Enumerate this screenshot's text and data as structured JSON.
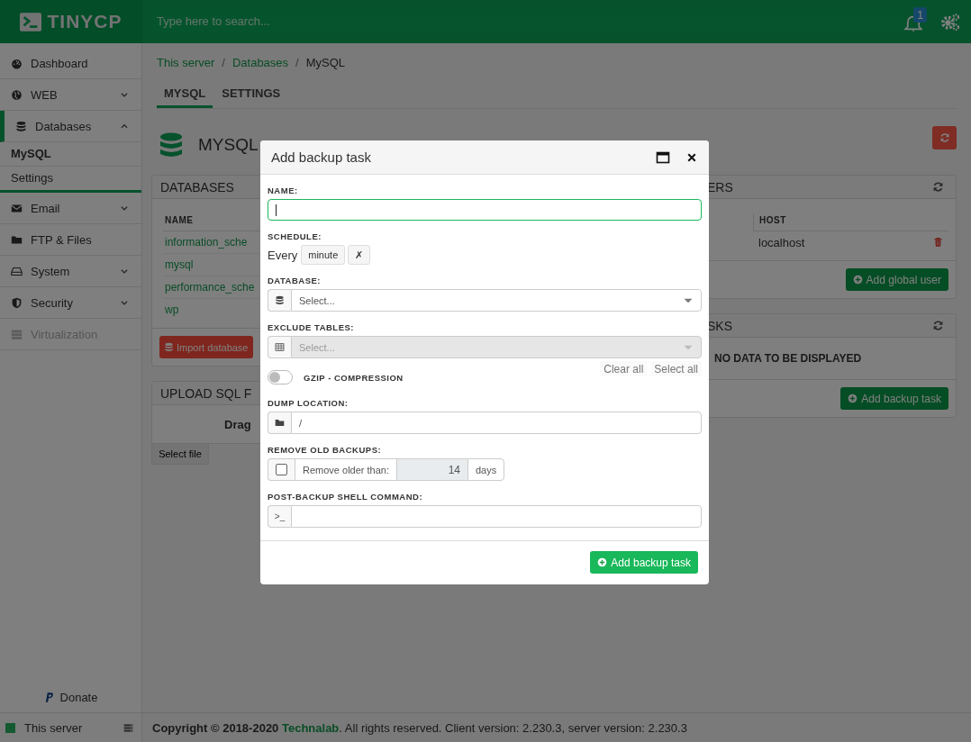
{
  "header": {
    "logo": "TINYCP",
    "search": {
      "placeholder": "Type here to search..."
    },
    "notifications": "1"
  },
  "sidebar": {
    "items": [
      {
        "kind": "link",
        "label": "Dashboard",
        "selected": false,
        "disabled": false
      },
      {
        "kind": "group",
        "label": "WEB",
        "selected": false,
        "expanded": false,
        "disabled": false
      },
      {
        "kind": "group",
        "label": "Databases",
        "selected": true,
        "expanded": true,
        "disabled": false,
        "children": [
          {
            "label": "MySQL",
            "selected": true
          },
          {
            "label": "Settings",
            "selected": false
          }
        ]
      },
      {
        "kind": "group",
        "label": "Email",
        "selected": false,
        "expanded": false,
        "disabled": false
      },
      {
        "kind": "link",
        "label": "FTP & Files",
        "selected": false,
        "disabled": false
      },
      {
        "kind": "group",
        "label": "System",
        "selected": false,
        "expanded": false,
        "disabled": false
      },
      {
        "kind": "group",
        "label": "Security",
        "selected": false,
        "expanded": false,
        "disabled": false
      },
      {
        "kind": "link",
        "label": "Virtualization",
        "selected": false,
        "disabled": true
      }
    ],
    "donate": "Donate",
    "server": "This server"
  },
  "breadcrumb": [
    {
      "kind": "link",
      "label": "This server"
    },
    {
      "kind": "separator",
      "label": "/"
    },
    {
      "kind": "link",
      "label": "Databases"
    },
    {
      "kind": "separator",
      "label": "/"
    },
    {
      "kind": "current",
      "label": "MySQL"
    }
  ],
  "tabs": [
    {
      "label": "MYSQL",
      "selected": true
    },
    {
      "label": "SETTINGS",
      "selected": false
    }
  ],
  "page": {
    "title": "MYSQL"
  },
  "databases_card": {
    "title": "DATABASES",
    "columns": [
      "NAME"
    ],
    "rows": [
      "information_sche",
      "mysql",
      "performance_sche",
      "wp"
    ],
    "button": "Import database"
  },
  "upload_card": {
    "title": "UPLOAD SQL F",
    "prompt": "Drag",
    "button": "Select file"
  },
  "users_card": {
    "title": "ERS",
    "columns": [
      "HOST"
    ],
    "rows": [
      "localhost"
    ],
    "button": "Add global user"
  },
  "tasks_card": {
    "title": "SKS",
    "empty": "NO DATA TO BE DISPLAYED",
    "button": "Add backup task"
  },
  "footer": {
    "copyright": "**Copyright © 2018-2020**",
    "company": "Technalab",
    "suffix": ". All rights reserved. Client version: 2.230.3, server version: 2.230.3"
  },
  "modal": {
    "title": "Add backup task",
    "fields": [
      {
        "kind": "text",
        "label": "NAME:",
        "focused": true
      },
      {
        "kind": "schedule",
        "label": "SCHEDULE:",
        "prefix": "Every",
        "value": "minute",
        "clear": "✗"
      },
      {
        "kind": "dbselect",
        "label": "DATABASE:",
        "placeholder": "Select...",
        "disabled": false
      },
      {
        "kind": "tableselect",
        "label": "EXCLUDE TABLES:",
        "placeholder": "Select...",
        "disabled": true,
        "actions": [
          "Clear all",
          "Select all"
        ]
      },
      {
        "kind": "toggle",
        "label": "GZIP - COMPRESSION",
        "on": false
      },
      {
        "kind": "path",
        "label": "DUMP LOCATION:",
        "value": "/"
      },
      {
        "kind": "retention",
        "label": "REMOVE OLD BACKUPS:",
        "checked": false,
        "text": "Remove older than:",
        "value": "14",
        "unit": "days"
      },
      {
        "kind": "command",
        "label": "POST-BACKUP SHELL COMMAND:",
        "prompt": ">_"
      }
    ],
    "submit": "Add backup task"
  }
}
